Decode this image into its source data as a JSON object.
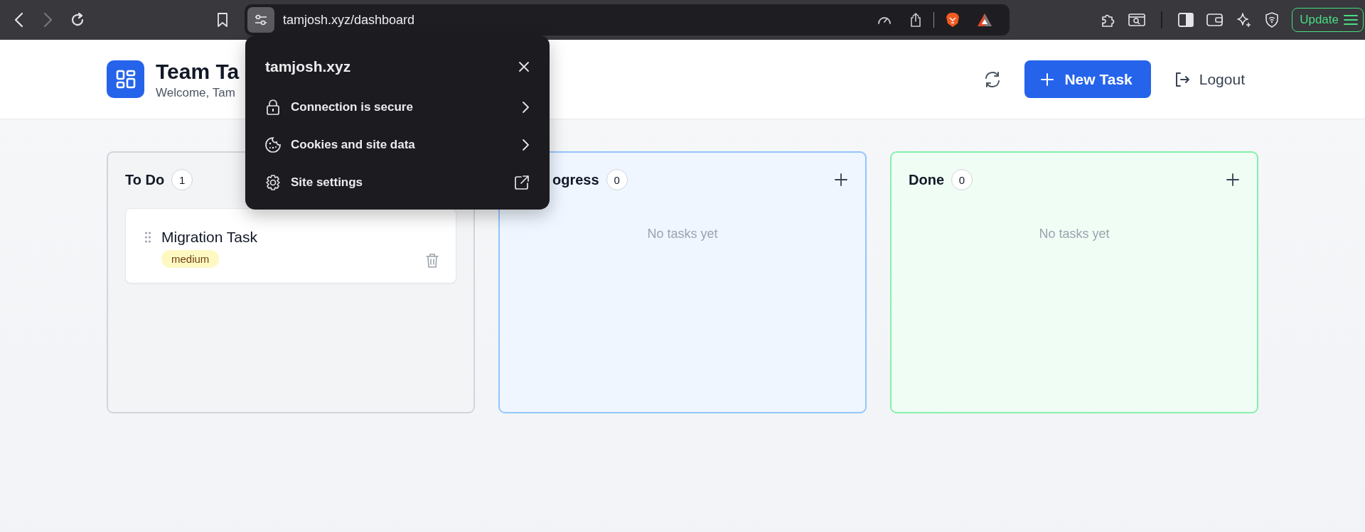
{
  "browser": {
    "url": "tamjosh.xyz/dashboard",
    "update_button": "Update"
  },
  "site_popup": {
    "title": "tamjosh.xyz",
    "items": [
      "Connection is secure",
      "Cookies and site data",
      "Site settings"
    ]
  },
  "header": {
    "title": "Team Ta",
    "subtitle": "Welcome, Tam",
    "new_task_button": "New Task",
    "logout_button": "Logout"
  },
  "columns": [
    {
      "title": "To Do",
      "count": "1",
      "color": "#d1d5db",
      "add_icon": false,
      "tasks": [
        {
          "title": "Migration Task",
          "priority": "medium"
        }
      ]
    },
    {
      "title": "ogress",
      "count": "0",
      "color": "#93c5fd",
      "add_icon": true,
      "empty_text": "No tasks yet"
    },
    {
      "title": "Done",
      "count": "0",
      "color": "#86efac",
      "add_icon": true,
      "empty_text": "No tasks yet"
    }
  ]
}
